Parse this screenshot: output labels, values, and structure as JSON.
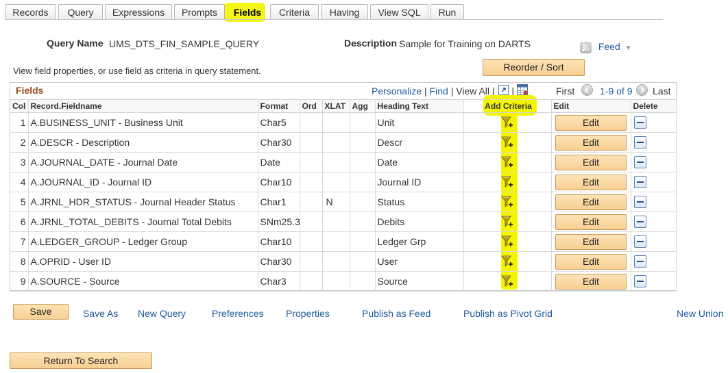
{
  "tabs": [
    {
      "label": "Records",
      "active": false
    },
    {
      "label": "Query",
      "active": false
    },
    {
      "label": "Expressions",
      "active": false
    },
    {
      "label": "Prompts",
      "active": false
    },
    {
      "label": "Fields",
      "active": true
    },
    {
      "label": "Criteria",
      "active": false
    },
    {
      "label": "Having",
      "active": false
    },
    {
      "label": "View SQL",
      "active": false
    },
    {
      "label": "Run",
      "active": false
    }
  ],
  "header": {
    "query_name_label": "Query Name",
    "query_name_value": "UMS_DTS_FIN_SAMPLE_QUERY",
    "description_label": "Description",
    "description_value": "Sample for Training on DARTS",
    "feed_label": "Feed",
    "instructions": "View field properties, or use field as criteria in query statement.",
    "reorder_button": "Reorder / Sort"
  },
  "grid": {
    "title": "Fields",
    "nav": {
      "personalize": "Personalize",
      "find": "Find",
      "view_all": "View All",
      "first": "First",
      "range": "1-9 of 9",
      "last": "Last"
    },
    "columns": [
      "Col",
      "Record.Fieldname",
      "Format",
      "Ord",
      "XLAT",
      "Agg",
      "Heading Text",
      "Add Criteria",
      "Edit",
      "Delete"
    ],
    "edit_label": "Edit",
    "rows": [
      {
        "col": "1",
        "field": "A.BUSINESS_UNIT - Business Unit",
        "format": "Char5",
        "ord": "",
        "xlat": "",
        "agg": "",
        "heading": "Unit"
      },
      {
        "col": "2",
        "field": "A.DESCR - Description",
        "format": "Char30",
        "ord": "",
        "xlat": "",
        "agg": "",
        "heading": "Descr"
      },
      {
        "col": "3",
        "field": "A.JOURNAL_DATE - Journal Date",
        "format": "Date",
        "ord": "",
        "xlat": "",
        "agg": "",
        "heading": "Date"
      },
      {
        "col": "4",
        "field": "A.JOURNAL_ID - Journal ID",
        "format": "Char10",
        "ord": "",
        "xlat": "",
        "agg": "",
        "heading": "Journal ID"
      },
      {
        "col": "5",
        "field": "A.JRNL_HDR_STATUS - Journal Header Status",
        "format": "Char1",
        "ord": "",
        "xlat": "N",
        "agg": "",
        "heading": "Status"
      },
      {
        "col": "6",
        "field": "A.JRNL_TOTAL_DEBITS - Journal Total Debits",
        "format": "SNm25.3",
        "ord": "",
        "xlat": "",
        "agg": "",
        "heading": "Debits"
      },
      {
        "col": "7",
        "field": "A.LEDGER_GROUP - Ledger Group",
        "format": "Char10",
        "ord": "",
        "xlat": "",
        "agg": "",
        "heading": "Ledger Grp"
      },
      {
        "col": "8",
        "field": "A.OPRID - User ID",
        "format": "Char30",
        "ord": "",
        "xlat": "",
        "agg": "",
        "heading": "User"
      },
      {
        "col": "9",
        "field": "A.SOURCE - Source",
        "format": "Char3",
        "ord": "",
        "xlat": "",
        "agg": "",
        "heading": "Source"
      }
    ]
  },
  "footer": {
    "save": "Save",
    "save_as": "Save As",
    "new_query": "New Query",
    "preferences": "Preferences",
    "properties": "Properties",
    "publish_feed": "Publish as Feed",
    "publish_pivot": "Publish as Pivot Grid",
    "new_union": "New Union",
    "return_to_search": "Return To Search"
  },
  "colors": {
    "highlight": "#f3f500",
    "link": "#1f5a9a",
    "grid_title": "#9b4b1a",
    "button_fill": "#f8cf93"
  },
  "icons": {
    "criteria": "funnel-add-icon",
    "delete": "minus-icon",
    "feed": "rss-feed-icon",
    "zoom": "zoom-icon",
    "download": "download-grid-icon"
  }
}
